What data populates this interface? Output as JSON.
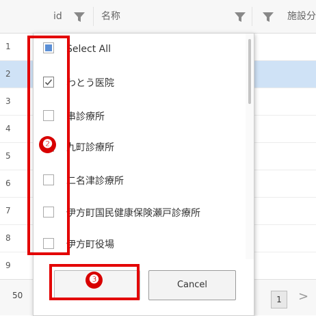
{
  "header": {
    "columns": [
      {
        "label": "id"
      },
      {
        "label": "名称"
      },
      {
        "label": "施設分"
      }
    ]
  },
  "rows": [
    "1",
    "2",
    "3",
    "4",
    "5",
    "6",
    "7",
    "8",
    "9"
  ],
  "filter_panel": {
    "options": [
      {
        "label": "Select All",
        "state": "indeterminate"
      },
      {
        "label": "わとう医院",
        "state": "checked"
      },
      {
        "label": "串診療所",
        "state": "unchecked"
      },
      {
        "label": "九町診療所",
        "state": "unchecked"
      },
      {
        "label": "二名津診療所",
        "state": "unchecked"
      },
      {
        "label": "伊方町国民健康保険瀬戸診療所",
        "state": "unchecked"
      },
      {
        "label": "伊方町役場",
        "state": "unchecked"
      }
    ],
    "ok_label": "",
    "cancel_label": "Cancel"
  },
  "annotations": {
    "badge_2": "❷",
    "badge_3": "❸"
  },
  "footer": {
    "page_size": "50",
    "current_page": "1",
    "next_symbol": ">"
  },
  "colors": {
    "accent": "#5b8fd6",
    "selected_row": "#cfe2f6",
    "annotation_red": "#e30000"
  }
}
